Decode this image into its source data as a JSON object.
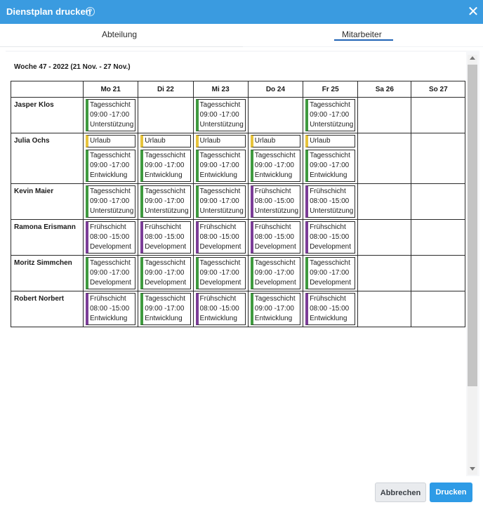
{
  "dialog": {
    "title": "Dienstplan drucken",
    "help_icon": "question-circle-icon",
    "close_icon": "close-icon"
  },
  "tabs": [
    {
      "label": "Abteilung",
      "active": false
    },
    {
      "label": "Mitarbeiter",
      "active": true
    }
  ],
  "week_label": "Woche 47 - 2022 (21 Nov. - 27 Nov.)",
  "days": [
    "Mo 21",
    "Di 22",
    "Mi 23",
    "Do 24",
    "Fr 25",
    "Sa 26",
    "So 27"
  ],
  "colors": {
    "accent": "#3a9be0",
    "tagesschicht": "#3f9a3f",
    "fruehschicht": "#7b3d97",
    "urlaub": "#e7c43c"
  },
  "employees": [
    {
      "name": "Jasper Klos",
      "days": [
        [
          {
            "type": "green",
            "lines": [
              "Tagesschicht",
              "09:00 -17:00",
              "Unterstützung"
            ]
          }
        ],
        [],
        [
          {
            "type": "green",
            "lines": [
              "Tagesschicht",
              "09:00 -17:00",
              "Unterstützung"
            ]
          }
        ],
        [],
        [
          {
            "type": "green",
            "lines": [
              "Tagesschicht",
              "09:00 -17:00",
              "Unterstützung"
            ]
          }
        ],
        [],
        []
      ]
    },
    {
      "name": "Julia Ochs",
      "days": [
        [
          {
            "type": "yellow",
            "lines": [
              "Urlaub"
            ]
          },
          {
            "type": "green",
            "lines": [
              "Tagesschicht",
              "09:00 -17:00",
              "Entwicklung"
            ]
          }
        ],
        [
          {
            "type": "yellow",
            "lines": [
              "Urlaub"
            ]
          },
          {
            "type": "green",
            "lines": [
              "Tagesschicht",
              "09:00 -17:00",
              "Entwicklung"
            ]
          }
        ],
        [
          {
            "type": "yellow",
            "lines": [
              "Urlaub"
            ]
          },
          {
            "type": "green",
            "lines": [
              "Tagesschicht",
              "09:00 -17:00",
              "Entwicklung"
            ]
          }
        ],
        [
          {
            "type": "yellow",
            "lines": [
              "Urlaub"
            ]
          },
          {
            "type": "green",
            "lines": [
              "Tagesschicht",
              "09:00 -17:00",
              "Entwicklung"
            ]
          }
        ],
        [
          {
            "type": "yellow",
            "lines": [
              "Urlaub"
            ]
          },
          {
            "type": "green",
            "lines": [
              "Tagesschicht",
              "09:00 -17:00",
              "Entwicklung"
            ]
          }
        ],
        [],
        []
      ]
    },
    {
      "name": "Kevin Maier",
      "days": [
        [
          {
            "type": "green",
            "lines": [
              "Tagesschicht",
              "09:00 -17:00",
              "Unterstützung"
            ]
          }
        ],
        [
          {
            "type": "green",
            "lines": [
              "Tagesschicht",
              "09:00 -17:00",
              "Unterstützung"
            ]
          }
        ],
        [
          {
            "type": "green",
            "lines": [
              "Tagesschicht",
              "09:00 -17:00",
              "Unterstützung"
            ]
          }
        ],
        [
          {
            "type": "purple",
            "lines": [
              "Frühschicht",
              "08:00 -15:00",
              "Unterstützung"
            ]
          }
        ],
        [
          {
            "type": "purple",
            "lines": [
              "Frühschicht",
              "08:00 -15:00",
              "Unterstützung"
            ]
          }
        ],
        [],
        []
      ]
    },
    {
      "name": "Ramona Erismann",
      "days": [
        [
          {
            "type": "purple",
            "lines": [
              "Frühschicht",
              "08:00 -15:00",
              "Development"
            ]
          }
        ],
        [
          {
            "type": "purple",
            "lines": [
              "Frühschicht",
              "08:00 -15:00",
              "Development"
            ]
          }
        ],
        [
          {
            "type": "purple",
            "lines": [
              "Frühschicht",
              "08:00 -15:00",
              "Development"
            ]
          }
        ],
        [
          {
            "type": "purple",
            "lines": [
              "Frühschicht",
              "08:00 -15:00",
              "Development"
            ]
          }
        ],
        [
          {
            "type": "purple",
            "lines": [
              "Frühschicht",
              "08:00 -15:00",
              "Development"
            ]
          }
        ],
        [],
        []
      ]
    },
    {
      "name": "Moritz Simmchen",
      "days": [
        [
          {
            "type": "green",
            "lines": [
              "Tagesschicht",
              "09:00 -17:00",
              "Development"
            ]
          }
        ],
        [
          {
            "type": "green",
            "lines": [
              "Tagesschicht",
              "09:00 -17:00",
              "Development"
            ]
          }
        ],
        [
          {
            "type": "green",
            "lines": [
              "Tagesschicht",
              "09:00 -17:00",
              "Development"
            ]
          }
        ],
        [
          {
            "type": "green",
            "lines": [
              "Tagesschicht",
              "09:00 -17:00",
              "Development"
            ]
          }
        ],
        [
          {
            "type": "green",
            "lines": [
              "Tagesschicht",
              "09:00 -17:00",
              "Development"
            ]
          }
        ],
        [],
        []
      ]
    },
    {
      "name": "Robert Norbert",
      "days": [
        [
          {
            "type": "purple",
            "lines": [
              "Frühschicht",
              "08:00 -15:00",
              "Entwicklung"
            ]
          }
        ],
        [
          {
            "type": "green",
            "lines": [
              "Tagesschicht",
              "09:00 -17:00",
              "Entwicklung"
            ]
          }
        ],
        [
          {
            "type": "purple",
            "lines": [
              "Frühschicht",
              "08:00 -15:00",
              "Entwicklung"
            ]
          }
        ],
        [
          {
            "type": "green",
            "lines": [
              "Tagesschicht",
              "09:00 -17:00",
              "Entwicklung"
            ]
          }
        ],
        [
          {
            "type": "purple",
            "lines": [
              "Frühschicht",
              "08:00 -15:00",
              "Entwicklung"
            ]
          }
        ],
        [],
        []
      ]
    }
  ],
  "footer": {
    "cancel_label": "Abbrechen",
    "print_label": "Drucken"
  }
}
